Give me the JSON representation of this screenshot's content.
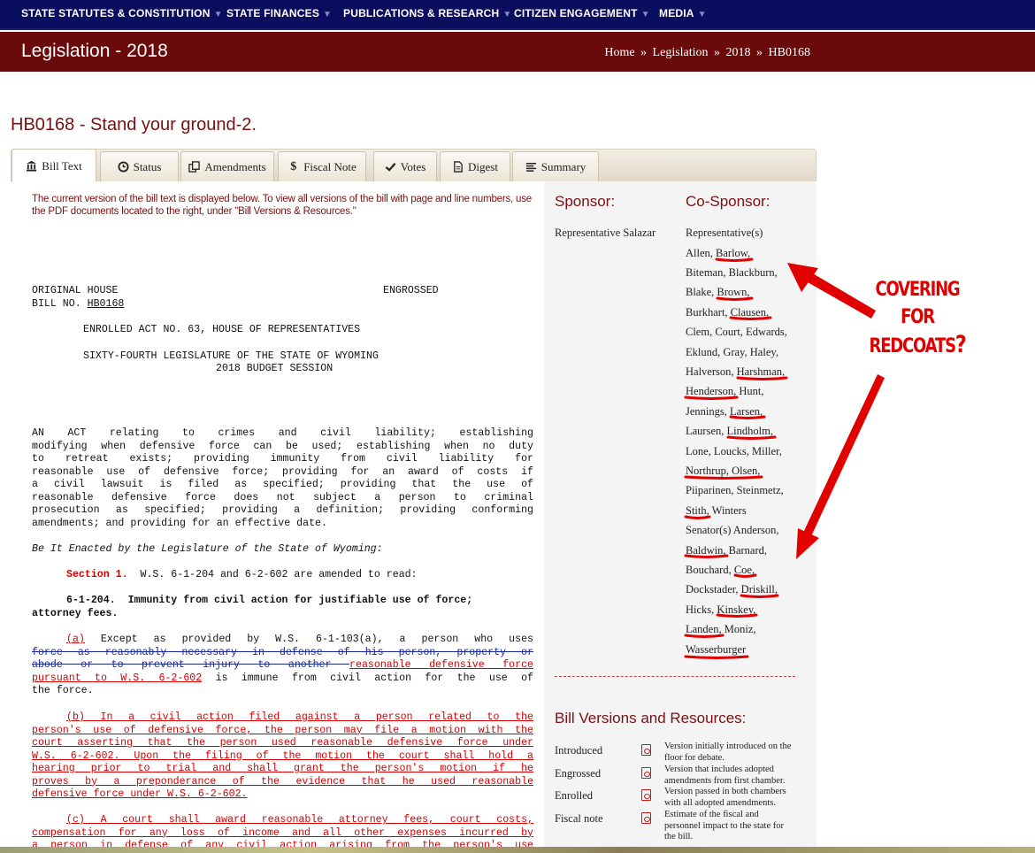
{
  "nav": {
    "items": [
      "STATE STATUTES & CONSTITUTION",
      "STATE FINANCES",
      "PUBLICATIONS & RESEARCH",
      "CITIZEN ENGAGEMENT",
      "MEDIA"
    ]
  },
  "header": {
    "title": "Legislation - 2018",
    "breadcrumb": [
      "Home",
      "Legislation",
      "2018",
      "HB0168"
    ],
    "separator": "»"
  },
  "bill": {
    "title": "HB0168 - Stand your ground-2."
  },
  "tabs": [
    "Bill Text",
    "Status",
    "Amendments",
    "Fiscal Note",
    "Votes",
    "Digest",
    "Summary"
  ],
  "notice": "The current version of the bill text is displayed below. To view all versions of the bill with page and line numbers, use the PDF documents located to the right, under \"Bill Versions & Resources.\"",
  "text": {
    "orig_house": "ORIGINAL HOUSE",
    "engrossed": "ENGROSSED",
    "bill_no": "BILL NO.",
    "bill_no_val": "HB0168",
    "enrolled": "ENROLLED ACT NO. 63, HOUSE OF REPRESENTATIVES",
    "legislature": "SIXTY-FOURTH LEGISLATURE OF THE STATE OF WYOMING",
    "session": "2018 BUDGET SESSION",
    "act_line1": "AN ACT relating to crimes and civil liability; establishing",
    "act_line2": "modifying when defensive force can be used; establishing when no duty",
    "act_line3": "to retreat exists; providing immunity from civil liability for",
    "act_line4": "reasonable use of defensive force; providing for an award of costs if",
    "act_line5": "a civil lawsuit is filed as specified; providing that the use of",
    "act_line6": "reasonable defensive force does not subject a person to criminal",
    "act_line7": "prosecution as specified; providing a definition; providing conforming",
    "act_line8": "amendments; and providing for an effective date.",
    "enacted": "Be It Enacted by the Legislature of the State of Wyoming:",
    "section_label": "Section 1.",
    "section_text": "W.S. 6-1-204 and 6-2-602 are amended to read:",
    "sec_num": "6-1-204.",
    "sec_head1": "Immunity from civil action for justifiable use of force;",
    "sec_head2": "attorney fees.",
    "a_label": "(a)",
    "a_text1": "Except as provided by W.S. 6-1-103(a), a person who uses",
    "a_strike1": "force as reasonably necessary in defense of his person, property or",
    "a_strike2": "abode or to prevent injury to another ",
    "a_red1": "reasonable defensive force",
    "a_red2": "pursuant to W.S. 6-2-602",
    "a_text2": " is immune from civil action for the use of",
    "a_text3": "the force.",
    "b_line1": "(b)  In a civil action filed against a person related to the",
    "b_line2": "person's use of defensive force, the person may file a motion with the",
    "b_line3": "court asserting that the person used reasonable defensive force under",
    "b_line4": "W.S. 6-2-602. Upon the filing of the motion the court shall hold a",
    "b_line5": "hearing prior to trial and shall grant the person's motion if he",
    "b_line6": "proves by a preponderance of the evidence that he used reasonable",
    "b_line7": "defensive force under W.S. 6-2-602.",
    "c_line1": "(c)  A court shall award reasonable attorney fees, court costs,",
    "c_line2": "compensation for any loss of income and all other expenses incurred by",
    "c_line3": "a person in defense of any civil action arising from the person's use"
  },
  "sidebar": {
    "sponsor_heading": "Sponsor:",
    "cosponsor_heading": "Co-Sponsor:",
    "sponsor": "Representative Salazar",
    "cosponsor_lines": [
      "Representative(s)",
      "Allen, Barlow,",
      "Biteman, Blackburn,",
      "Blake, Brown,",
      "Burkhart, Clausen,",
      "Clem, Court, Edwards,",
      "Eklund, Gray, Haley,",
      "Halverson, Harshman,",
      "Henderson, Hunt,",
      "Jennings, Larsen,",
      "Laursen, Lindholm,",
      "Lone, Loucks, Miller,",
      "Northrup, Olsen,",
      "Piiparinen, Steinmetz,",
      "Stith, Winters",
      "Senator(s) Anderson,",
      "Baldwin, Barnard,",
      "Bouchard, Coe,",
      "Dockstader, Driskill,",
      "Hicks, Kinskey,",
      "Landen, Moniz,",
      "Wasserburger"
    ],
    "versions_heading": "Bill Versions and Resources:",
    "versions": [
      {
        "label": "Introduced",
        "desc": "Version initially introduced on the floor for debate."
      },
      {
        "label": "Engrossed",
        "desc": "Version that includes adopted amendments from first chamber."
      },
      {
        "label": "Enrolled",
        "desc": "Version passed in both chambers with all adopted amendments."
      },
      {
        "label": "Fiscal note",
        "desc": "Estimate of the fiscal and personnel impact to the state for the bill."
      }
    ]
  },
  "annotation": {
    "line1": "COVERING",
    "line2": "FOR",
    "line3": "REDCOATS",
    "mark": "?",
    "color": "#e10000"
  }
}
